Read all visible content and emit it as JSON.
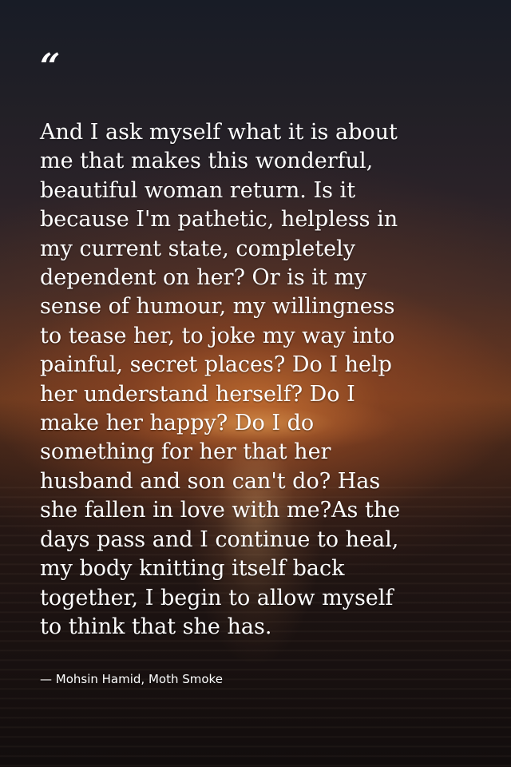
{
  "quote": {
    "open_mark": "“",
    "lines": [
      "And I ask myself what it is about",
      "me that makes this wonderful,",
      "beautiful woman return. Is it",
      "because I'm pathetic, helpless in",
      "my current state, completely",
      "dependent on her? Or is it my",
      "sense of humour, my willingness",
      "to tease her, to joke my way into",
      "painful, secret places? Do I help",
      "her understand herself? Do I",
      "make her happy? Do I do",
      "something for her that her",
      "husband and son can't do? Has",
      "she fallen in love with me?As the",
      "days pass and I continue to heal,",
      "my body knitting itself back",
      "together, I begin to allow myself",
      "to think that she has."
    ],
    "attribution": "— Mohsin Hamid, Moth Smoke"
  }
}
